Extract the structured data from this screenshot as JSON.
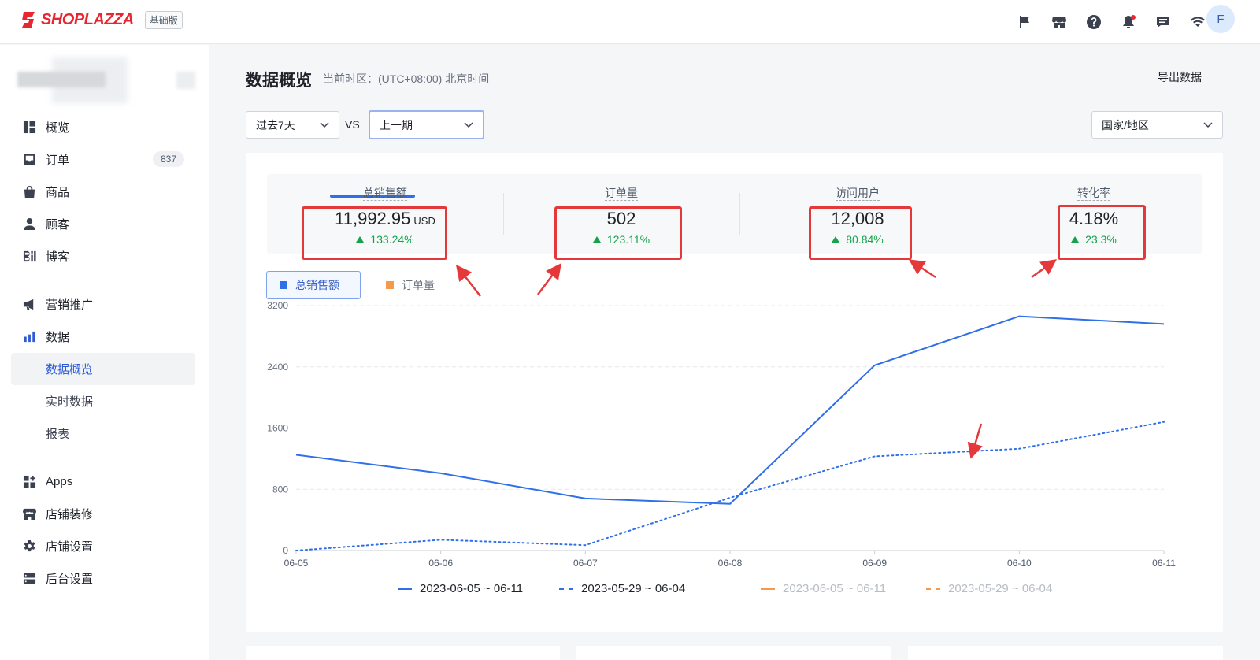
{
  "header": {
    "brand": "SHOPLAZZA",
    "edition": "基础版",
    "avatar_initial": "F",
    "icons": [
      "flag-icon",
      "store-icon",
      "help-icon",
      "bell-icon",
      "message-icon",
      "wifi-icon"
    ]
  },
  "sidebar": {
    "items": [
      {
        "label": "概览",
        "icon": "dashboard-icon"
      },
      {
        "label": "订单",
        "icon": "inbox-icon",
        "badge": "837"
      },
      {
        "label": "商品",
        "icon": "bag-icon"
      },
      {
        "label": "顾客",
        "icon": "person-icon"
      },
      {
        "label": "博客",
        "icon": "blog-icon"
      },
      {
        "label": "营销推广",
        "icon": "megaphone-icon"
      },
      {
        "label": "数据",
        "icon": "bar-chart-icon"
      },
      {
        "label": "数据概览"
      },
      {
        "label": "实时数据"
      },
      {
        "label": "报表"
      },
      {
        "label": "Apps",
        "icon": "apps-icon"
      },
      {
        "label": "店铺装修",
        "icon": "storefront-icon"
      },
      {
        "label": "店铺设置",
        "icon": "gear-icon"
      },
      {
        "label": "后台设置",
        "icon": "server-icon"
      }
    ]
  },
  "main": {
    "title": "数据概览",
    "timezone": "当前时区：(UTC+08:00) 北京时间",
    "export_label": "导出数据",
    "period_select": "过去7天",
    "vs_label": "VS",
    "compare_select": "上一期",
    "region_select": "国家/地区"
  },
  "metrics": [
    {
      "label": "总销售额",
      "value": "11,992.95",
      "unit": "USD",
      "change": "133.24%"
    },
    {
      "label": "订单量",
      "value": "502",
      "change": "123.11%"
    },
    {
      "label": "访问用户",
      "value": "12,008",
      "change": "80.84%"
    },
    {
      "label": "转化率",
      "value": "4.18%",
      "change": "23.3%"
    }
  ],
  "series_buttons": [
    {
      "label": "总销售额",
      "color": "#2f6fe8"
    },
    {
      "label": "订单量",
      "color": "#f59a4a"
    }
  ],
  "colors": {
    "primary": "#2f6fe8",
    "secondary": "#f59a4a",
    "positive": "#15a34a",
    "annotation": "#e5383b"
  },
  "chart_data": {
    "type": "line",
    "categories": [
      "06-05",
      "06-06",
      "06-07",
      "06-08",
      "06-09",
      "06-10",
      "06-11"
    ],
    "yticks": [
      0,
      800,
      1600,
      2400,
      3200
    ],
    "ylim": [
      0,
      3400
    ],
    "grid": true,
    "legend": "bottom",
    "series": [
      {
        "name": "2023-06-05 ~ 06-11",
        "values": [
          1250,
          1010,
          680,
          610,
          2420,
          3060,
          2960
        ],
        "color": "#2f6fe8",
        "dash": "solid",
        "active": true
      },
      {
        "name": "2023-05-29 ~ 06-04",
        "values": [
          0,
          140,
          70,
          690,
          1230,
          1330,
          1680
        ],
        "color": "#2f6fe8",
        "dash": "dotted",
        "active": true
      },
      {
        "name": "2023-06-05 ~ 06-11",
        "values": [],
        "color": "#f59a4a",
        "dash": "solid",
        "active": false
      },
      {
        "name": "2023-05-29 ~ 06-04",
        "values": [],
        "color": "#f59a4a",
        "dash": "dashed",
        "active": false
      }
    ]
  }
}
